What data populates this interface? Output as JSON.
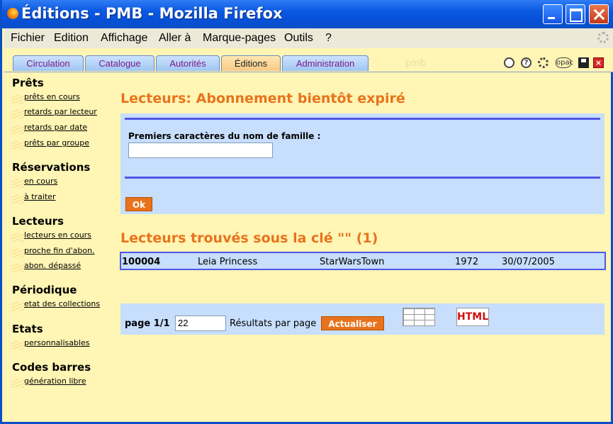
{
  "window": {
    "title": "Éditions - PMB - Mozilla Firefox"
  },
  "menu": [
    "Fichier",
    "Edition",
    "Affichage",
    "Aller à",
    "Marque-pages",
    "Outils",
    "?"
  ],
  "tabs": [
    "Circulation",
    "Catalogue",
    "Autorités",
    "Éditions",
    "Administration"
  ],
  "active_tab": "Éditions",
  "watermark": "pmb",
  "toolbar_icons": [
    "print-icon",
    "help-icon",
    "settings-icon",
    "opac-icon",
    "save-icon",
    "close-icon"
  ],
  "toolbar_opac_label": "opac",
  "sidebar": {
    "sections": [
      {
        "title": "Prêts",
        "links": [
          "prêts en cours",
          "retards par lecteur",
          "retards par date",
          "prêts par groupe"
        ]
      },
      {
        "title": "Réservations",
        "links": [
          "en cours",
          "à traiter"
        ]
      },
      {
        "title": "Lecteurs",
        "links": [
          "lecteurs en cours",
          "proche fin d'abon.",
          "abon. dépassé"
        ]
      },
      {
        "title": "Périodique",
        "links": [
          "etat des collections"
        ]
      },
      {
        "title": "Etats",
        "links": [
          "personnalisables"
        ]
      },
      {
        "title": "Codes barres",
        "links": [
          "génération libre"
        ]
      }
    ]
  },
  "main": {
    "heading": "Lecteurs: Abonnement bientôt expiré",
    "form_label": "Premiers caractères du nom de famille :",
    "form_value": "",
    "ok_label": "Ok",
    "results_heading": "Lecteurs trouvés sous la clé \"\" (1)",
    "results": [
      {
        "id": "100004",
        "name": "Leia Princess",
        "city": "StarWarsTown",
        "year": "1972",
        "date": "30/07/2005"
      }
    ],
    "pager": {
      "page_label": "page 1/1",
      "per_page": "22",
      "per_page_label": "Résultats par page",
      "update_label": "Actualiser",
      "html_label": "HTML"
    }
  }
}
